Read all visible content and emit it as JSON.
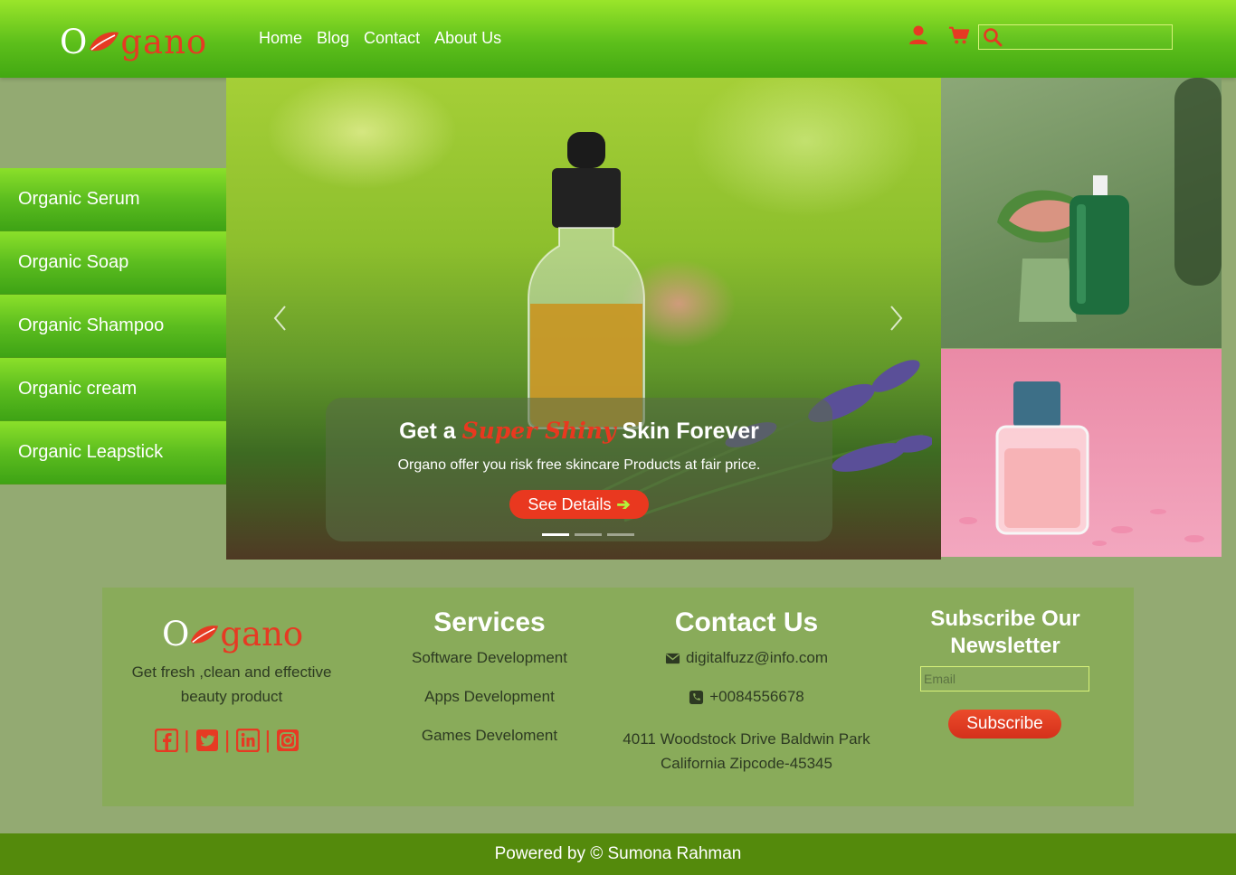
{
  "header": {
    "logo_first": "O",
    "logo_rest": "gano",
    "nav": [
      "Home",
      "Blog",
      "Contact",
      "About Us"
    ],
    "search_placeholder": ""
  },
  "sidebar": {
    "items": [
      {
        "label": "Organic Serum"
      },
      {
        "label": "Organic Soap"
      },
      {
        "label": "Organic Shampoo"
      },
      {
        "label": "Organic cream"
      },
      {
        "label": "Organic Leapstick"
      }
    ]
  },
  "hero": {
    "title_prefix": "Get a",
    "title_highlight": "Super Shiny",
    "title_suffix": "Skin Forever",
    "subtitle": "Organo offer you risk free skincare Products at fair price.",
    "button_label": "See Details",
    "slide_count": 3,
    "active_slide": 1
  },
  "footer": {
    "logo_first": "O",
    "logo_rest": "gano",
    "tagline": "Get fresh ,clean and effective beauty product",
    "social_icons": [
      "facebook-icon",
      "twitter-icon",
      "linkedin-icon",
      "instagram-icon"
    ],
    "services_title": "Services",
    "services": [
      "Software Development",
      "Apps Development",
      "Games Develoment"
    ],
    "contact_title": "Contact Us",
    "email": "digitalfuzz@info.com",
    "phone": "+0084556678",
    "address": "4011 Woodstock Drive Baldwin Park California Zipcode-45345",
    "newsletter_title": "Subscribe Our Newsletter",
    "email_placeholder": "Email",
    "subscribe_label": "Subscribe"
  },
  "copyright": "Powered by © Sumona Rahman",
  "colors": {
    "accent": "#e63a23",
    "header_green": "#5dbf1b",
    "page_bg": "#93aa72",
    "footer_box": "#89ab5a",
    "bottom_bar": "#548a0c"
  }
}
